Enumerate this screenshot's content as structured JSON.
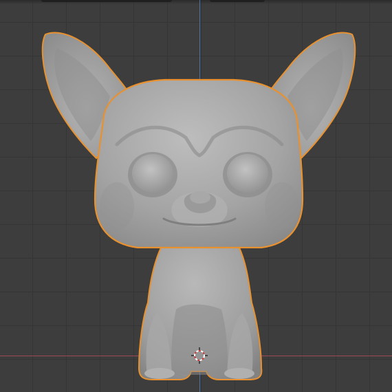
{
  "viewport": {
    "background_color": "#3d3d3d",
    "grid_color": "#353535",
    "axis_z_color": "#4d7bb7",
    "axis_x_color": "#b04a5a"
  },
  "model": {
    "selected": true,
    "selection_outline_color": "#e8912e",
    "surface_color": "#a6a6a6"
  },
  "cursor": {
    "icon": "3d-cursor-icon",
    "ring_colors": [
      "#d23c3c",
      "#ffffff"
    ]
  }
}
